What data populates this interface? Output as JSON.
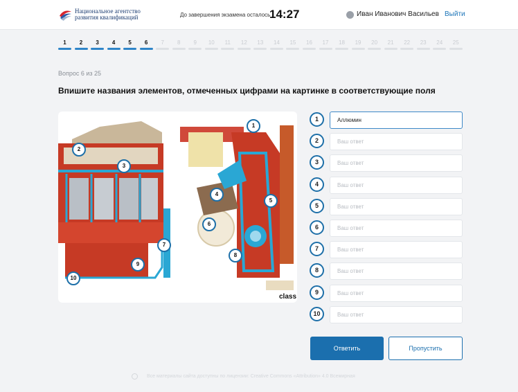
{
  "header": {
    "logo_line1": "Национальное агентство",
    "logo_line2": "развития квалификаций",
    "timer_label": "До завершения экзамена осталось",
    "timer_value": "14:27",
    "user_name": "Иван Иванович Васильев",
    "logout_label": "Выйти"
  },
  "progress": {
    "steps": [
      "1",
      "2",
      "3",
      "4",
      "5",
      "6",
      "7",
      "8",
      "9",
      "10",
      "11",
      "12",
      "13",
      "14",
      "15",
      "16",
      "17",
      "18",
      "19",
      "20",
      "21",
      "22",
      "23",
      "24",
      "25"
    ],
    "completed": 6,
    "colors": {
      "done": "#2f85c8",
      "todo": "#dde0e4"
    }
  },
  "question": {
    "counter": "Вопрос 6 из 25",
    "text": "Впишите названия элементов, отмеченных цифрами на картинке в соответствующие поля"
  },
  "image": {
    "caption": "class",
    "markers": [
      "1",
      "2",
      "3",
      "4",
      "5",
      "6",
      "7",
      "8",
      "9",
      "10"
    ]
  },
  "answers": [
    {
      "num": "1",
      "value": "Аллюмин",
      "placeholder": "Ваш ответ"
    },
    {
      "num": "2",
      "value": "",
      "placeholder": "Ваш ответ"
    },
    {
      "num": "3",
      "value": "",
      "placeholder": "Ваш ответ"
    },
    {
      "num": "4",
      "value": "",
      "placeholder": "Ваш ответ"
    },
    {
      "num": "5",
      "value": "",
      "placeholder": "Ваш ответ"
    },
    {
      "num": "6",
      "value": "",
      "placeholder": "Ваш ответ"
    },
    {
      "num": "7",
      "value": "",
      "placeholder": "Ваш ответ"
    },
    {
      "num": "8",
      "value": "",
      "placeholder": "Ваш ответ"
    },
    {
      "num": "9",
      "value": "",
      "placeholder": "Ваш ответ"
    },
    {
      "num": "10",
      "value": "",
      "placeholder": "Ваш ответ"
    }
  ],
  "buttons": {
    "submit_label": "Ответить",
    "skip_label": "Пропустить"
  },
  "footer": {
    "text": "Все материалы сайта доступны по лицензии: Creative Commons «Attribution» 4.0 Всемирная"
  },
  "colors": {
    "accent": "#1b6fae",
    "engine_red": "#c63a25",
    "engine_blue": "#2aa7d4"
  }
}
